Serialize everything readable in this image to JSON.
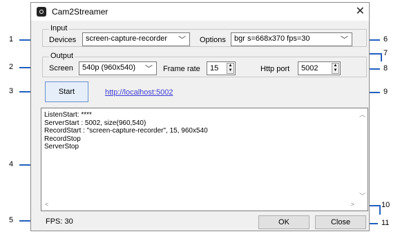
{
  "window": {
    "title": "Cam2Streamer"
  },
  "input": {
    "group_label": "Input",
    "devices_label": "Devices",
    "devices_value": "screen-capture-recorder",
    "options_label": "Options",
    "options_value": "bgr s=668x370 fps=30"
  },
  "output": {
    "group_label": "Output",
    "screen_label": "Screen",
    "screen_value": "540p (960x540)",
    "framerate_label": "Frame rate",
    "framerate_value": "15",
    "httpport_label": "Http port",
    "httpport_value": "5002"
  },
  "actions": {
    "start_label": "Start",
    "stream_link": "http://localhost:5002",
    "ok_label": "OK",
    "close_label": "Close"
  },
  "log": {
    "lines": [
      "ListenStart: ****",
      "ServerStart : 5002, size(960,540)",
      "RecordStart : \"screen-capture-recorder\", 15, 960x540",
      "RecordStop",
      "ServerStop"
    ]
  },
  "status": {
    "fps": "FPS: 30"
  },
  "callouts": [
    "1",
    "2",
    "3",
    "4",
    "5",
    "6",
    "7",
    "8",
    "9",
    "10",
    "11"
  ]
}
